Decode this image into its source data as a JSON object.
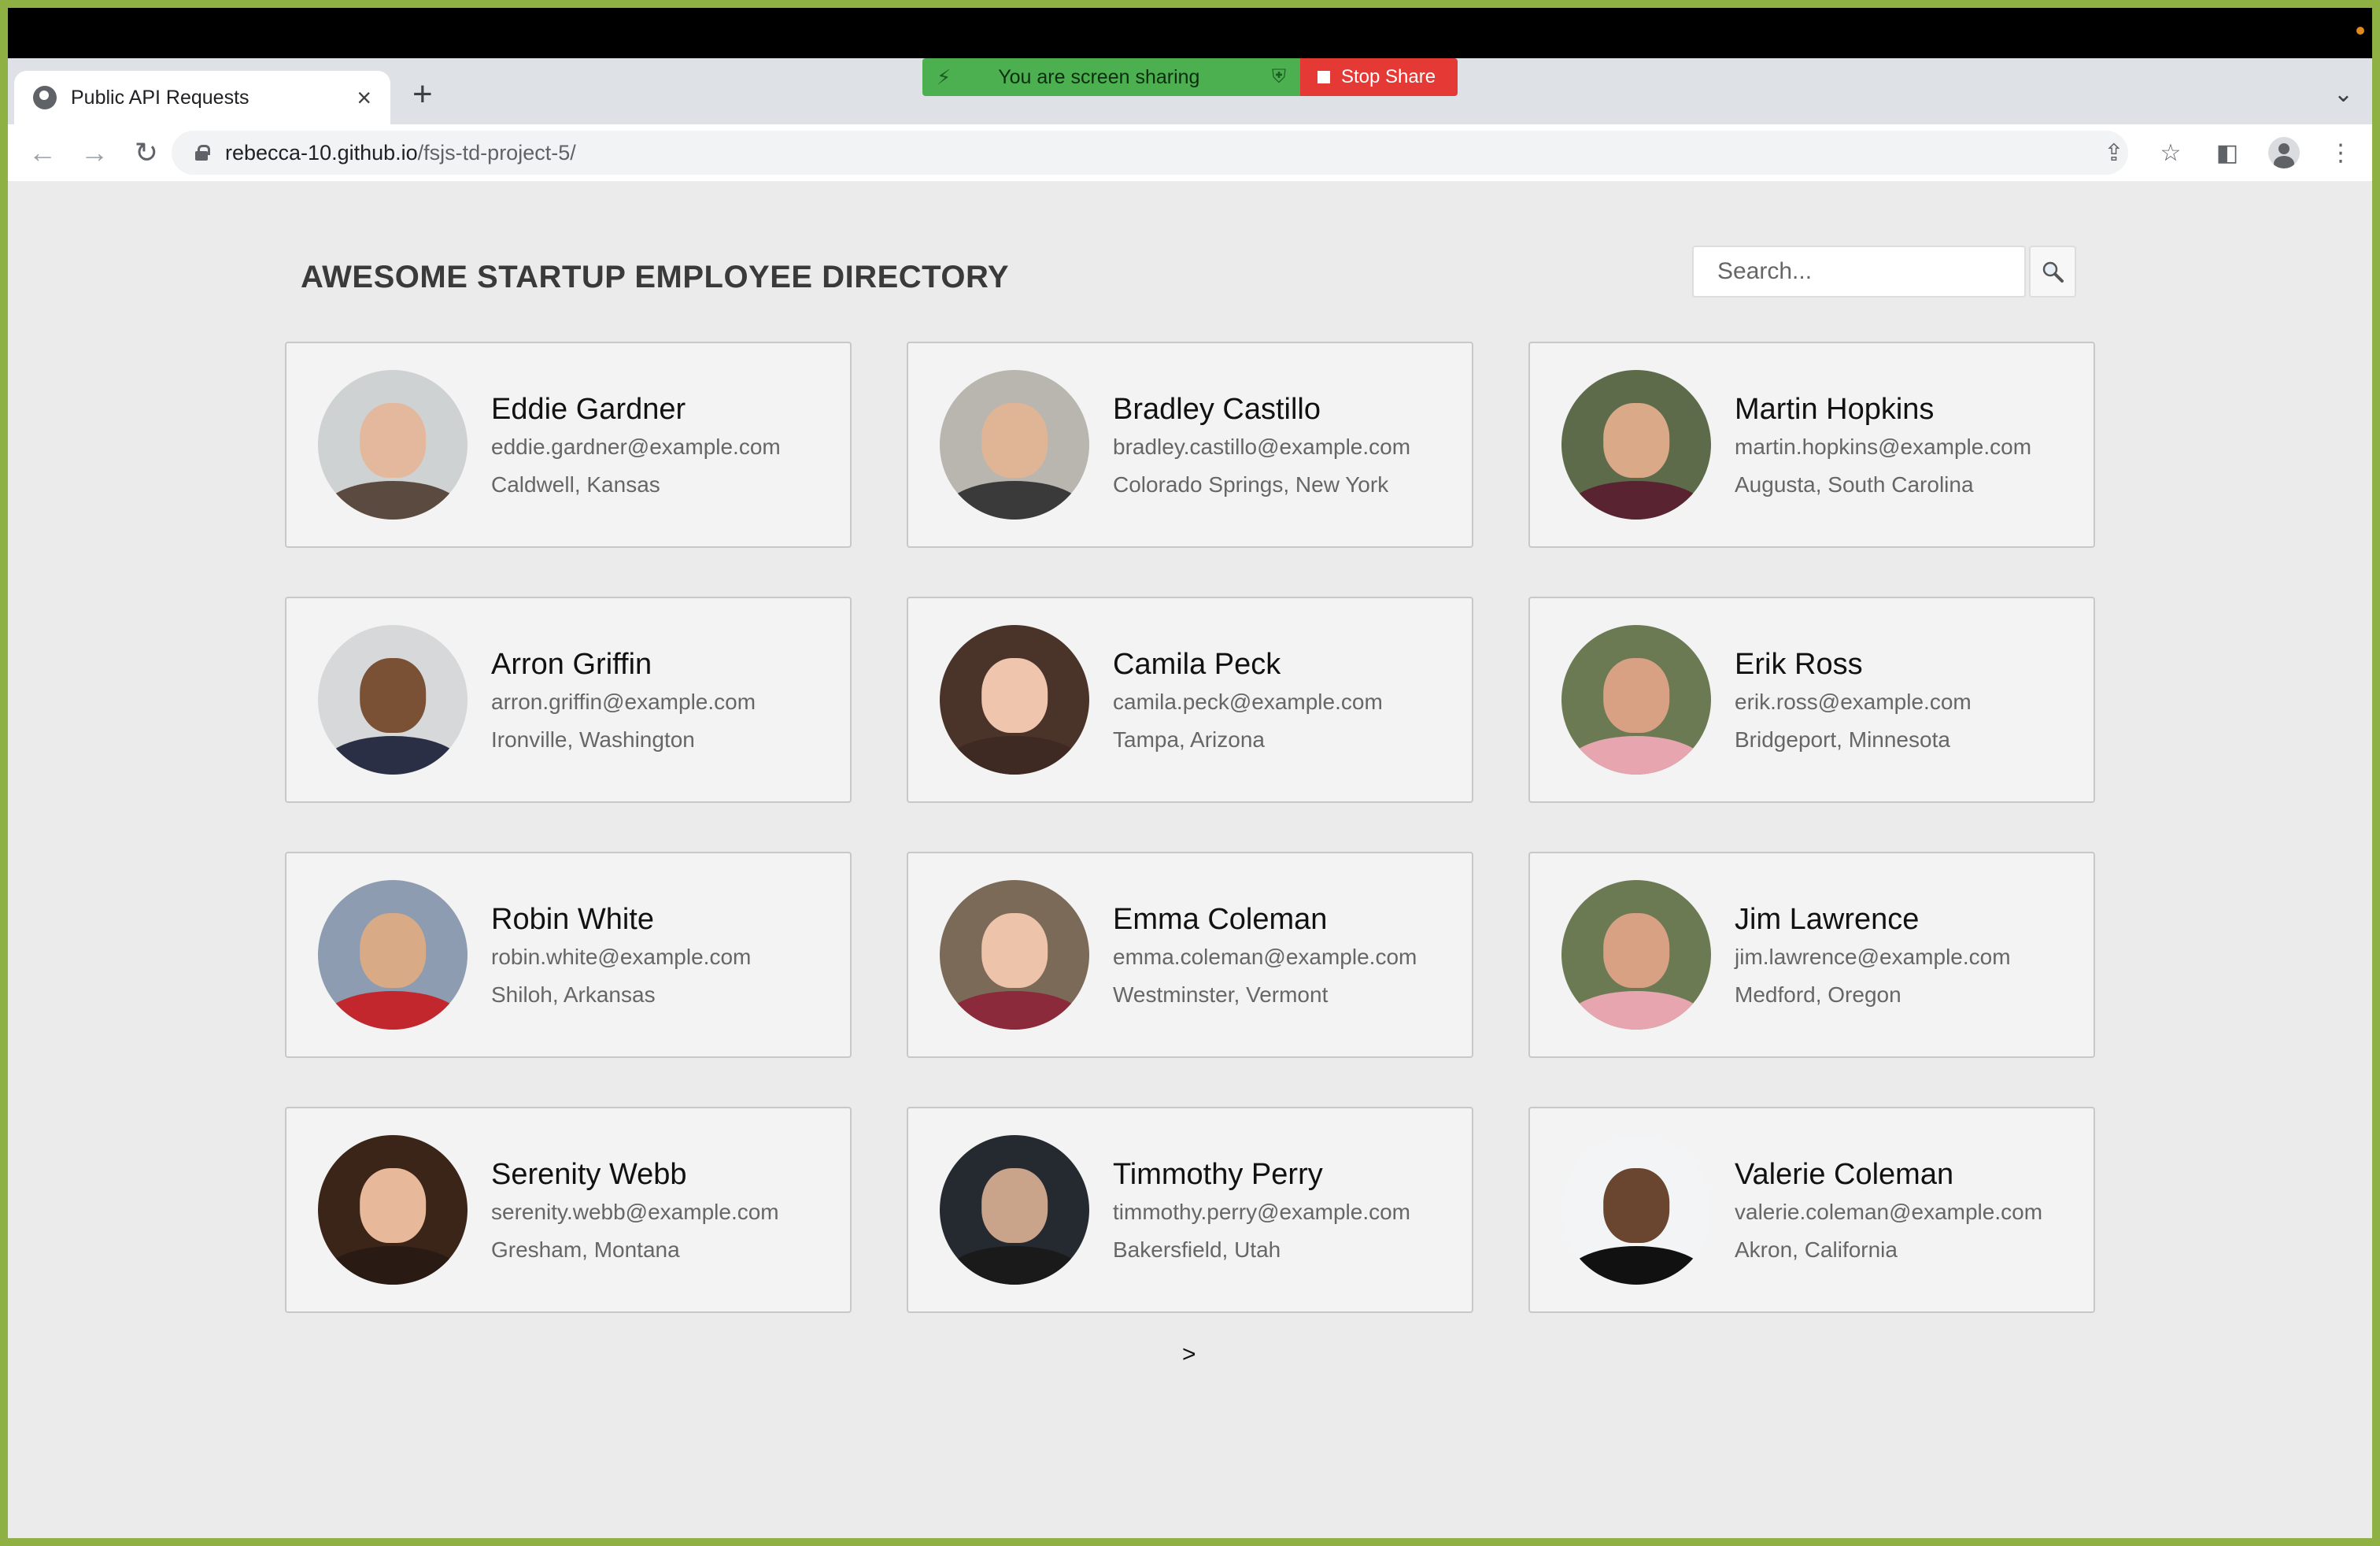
{
  "browser": {
    "tab_title": "Public API Requests",
    "new_tab_symbol": "+",
    "url_host": "rebecca-10.github.io",
    "url_path": "/fsjs-td-project-5/"
  },
  "screen_share": {
    "message": "You are screen sharing",
    "stop_label": "Stop Share"
  },
  "header": {
    "title": "AWESOME STARTUP EMPLOYEE DIRECTORY",
    "search_placeholder": "Search..."
  },
  "employees": [
    {
      "name": "Eddie Gardner",
      "email": "eddie.gardner@example.com",
      "location": "Caldwell, Kansas",
      "bg": "#cfd2d3",
      "skin": "#e3b89c",
      "shirt": "#5a4a40"
    },
    {
      "name": "Bradley Castillo",
      "email": "bradley.castillo@example.com",
      "location": "Colorado Springs, New York",
      "bg": "#b9b6b0",
      "skin": "#e0b596",
      "shirt": "#3a3a3a"
    },
    {
      "name": "Martin Hopkins",
      "email": "martin.hopkins@example.com",
      "location": "Augusta, South Carolina",
      "bg": "#5d6b4a",
      "skin": "#d9a988",
      "shirt": "#5a2331"
    },
    {
      "name": "Arron Griffin",
      "email": "arron.griffin@example.com",
      "location": "Ironville, Washington",
      "bg": "#d6d8da",
      "skin": "#7a5135",
      "shirt": "#2b2f45"
    },
    {
      "name": "Camila Peck",
      "email": "camila.peck@example.com",
      "location": "Tampa, Arizona",
      "bg": "#4a3328",
      "skin": "#efc6ad",
      "shirt": "#3e2a22"
    },
    {
      "name": "Erik Ross",
      "email": "erik.ross@example.com",
      "location": "Bridgeport, Minnesota",
      "bg": "#6c7a54",
      "skin": "#d8a184",
      "shirt": "#e7a5b0"
    },
    {
      "name": "Robin White",
      "email": "robin.white@example.com",
      "location": "Shiloh, Arkansas",
      "bg": "#8d9cb0",
      "skin": "#d8aa86",
      "shirt": "#c1272d"
    },
    {
      "name": "Emma Coleman",
      "email": "emma.coleman@example.com",
      "location": "Westminster, Vermont",
      "bg": "#7c6a58",
      "skin": "#edc3aa",
      "shirt": "#8a2a3b"
    },
    {
      "name": "Jim Lawrence",
      "email": "jim.lawrence@example.com",
      "location": "Medford, Oregon",
      "bg": "#6c7a54",
      "skin": "#d8a184",
      "shirt": "#e7a5b0"
    },
    {
      "name": "Serenity Webb",
      "email": "serenity.webb@example.com",
      "location": "Gresham, Montana",
      "bg": "#3b2418",
      "skin": "#e7b99a",
      "shirt": "#2a1a14"
    },
    {
      "name": "Timmothy Perry",
      "email": "timmothy.perry@example.com",
      "location": "Bakersfield, Utah",
      "bg": "#252a30",
      "skin": "#c9a48a",
      "shirt": "#1a1a1a"
    },
    {
      "name": "Valerie Coleman",
      "email": "valerie.coleman@example.com",
      "location": "Akron, California",
      "bg": "#f2f4f5",
      "skin": "#6a4630",
      "shirt": "#111111"
    }
  ],
  "pagination": {
    "next_label": ">"
  }
}
